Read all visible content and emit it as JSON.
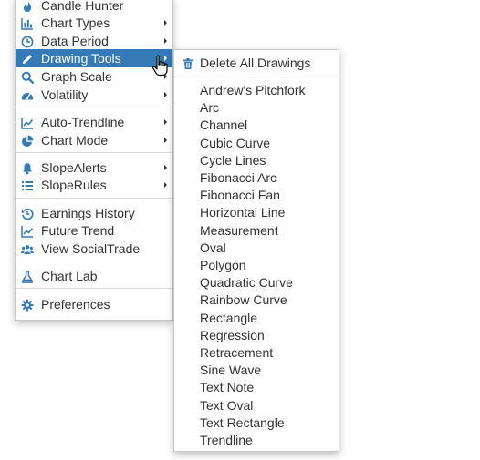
{
  "colors": {
    "icon": "#337ab7",
    "active_bg": "#337ab7",
    "active_text": "#ffffff"
  },
  "main_menu": [
    {
      "label": "Candle Hunter",
      "icon": "flame-icon",
      "submenu": false
    },
    {
      "label": "Chart Types",
      "icon": "bar-chart-icon",
      "submenu": true
    },
    {
      "label": "Data Period",
      "icon": "clock-icon",
      "submenu": true
    },
    {
      "label": "Drawing Tools",
      "icon": "pencil-icon",
      "submenu": true,
      "active": true
    },
    {
      "label": "Graph Scale",
      "icon": "magnifier-icon",
      "submenu": true
    },
    {
      "label": "Volatility",
      "icon": "gauge-icon",
      "submenu": true
    },
    {
      "label": "Auto-Trendline",
      "icon": "line-chart-icon",
      "submenu": true
    },
    {
      "label": "Chart Mode",
      "icon": "pie-chart-icon",
      "submenu": true
    },
    {
      "label": "SlopeAlerts",
      "icon": "bell-icon",
      "submenu": true
    },
    {
      "label": "SlopeRules",
      "icon": "list-icon",
      "submenu": true
    },
    {
      "label": "Earnings History",
      "icon": "history-icon",
      "submenu": false
    },
    {
      "label": "Future Trend",
      "icon": "line-chart-icon",
      "submenu": false
    },
    {
      "label": "View SocialTrade",
      "icon": "users-icon",
      "submenu": false
    },
    {
      "label": "Chart Lab",
      "icon": "flask-icon",
      "submenu": false
    },
    {
      "label": "Preferences",
      "icon": "gear-icon",
      "submenu": false
    }
  ],
  "sub_menu": {
    "delete_label": "Delete All Drawings",
    "delete_icon": "trash-icon",
    "tools": [
      "Andrew's Pitchfork",
      "Arc",
      "Channel",
      "Cubic Curve",
      "Cycle Lines",
      "Fibonacci Arc",
      "Fibonacci Fan",
      "Horizontal Line",
      "Measurement",
      "Oval",
      "Polygon",
      "Quadratic Curve",
      "Rainbow Curve",
      "Rectangle",
      "Regression",
      "Retracement",
      "Sine Wave",
      "Text Note",
      "Text Oval",
      "Text Rectangle",
      "Trendline"
    ]
  }
}
